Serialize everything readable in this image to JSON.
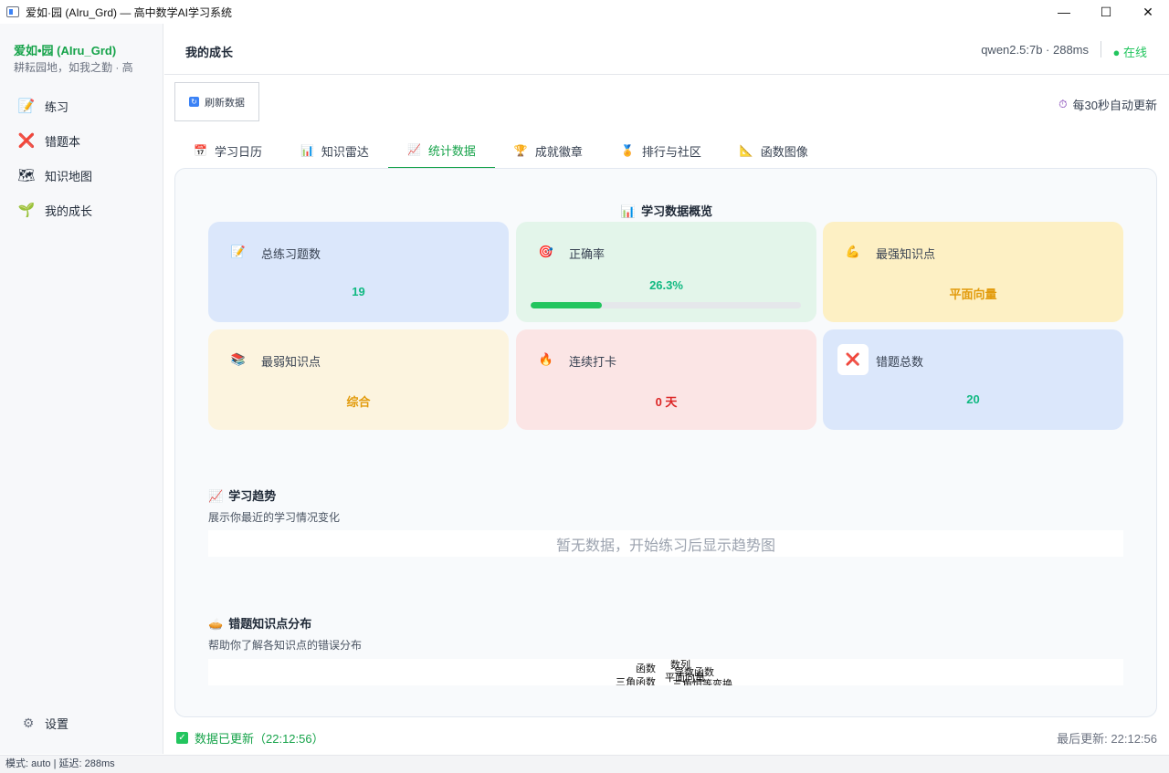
{
  "window": {
    "title": "爱如·园 (AIru_Grd) — 高中数学AI学习系统",
    "minimize_glyph": "—",
    "maximize_glyph": "☐",
    "close_glyph": "✕"
  },
  "sidebar": {
    "brand": "爱如•园 (AIru_Grd)",
    "slogan": "耕耘园地，如我之勤 · 高",
    "items": [
      {
        "label": "练习",
        "icon": "pencil-paper-icon",
        "glyph": "📝"
      },
      {
        "label": "错题本",
        "icon": "red-cross-icon",
        "glyph": "❌"
      },
      {
        "label": "知识地图",
        "icon": "world-map-icon",
        "glyph": "🗺"
      },
      {
        "label": "我的成长",
        "icon": "seedling-icon",
        "glyph": "🌱"
      }
    ],
    "settings": {
      "label": "设置",
      "icon": "gear-icon",
      "glyph": "⚙"
    }
  },
  "header": {
    "page_title": "我的成长",
    "model_info": "qwen2.5:7b · 288ms",
    "online_status": "● 在线"
  },
  "toolbar": {
    "refresh_label": "刷新数据",
    "auto_update": "每30秒自动更新"
  },
  "tabs": [
    {
      "label": "学习日历",
      "icon": "calendar-icon",
      "glyph": "📅"
    },
    {
      "label": "知识雷达",
      "icon": "bar-chart-icon",
      "glyph": "📊"
    },
    {
      "label": "统计数据",
      "icon": "trend-chart-icon",
      "glyph": "📈",
      "active": true
    },
    {
      "label": "成就徽章",
      "icon": "trophy-icon",
      "glyph": "🏆"
    },
    {
      "label": "排行与社区",
      "icon": "medal-icon",
      "glyph": "🏅"
    },
    {
      "label": "函数图像",
      "icon": "triangle-ruler-icon",
      "glyph": "📐"
    }
  ],
  "overview": {
    "title": "学习数据概览",
    "icon": "bar-chart-icon",
    "cards": [
      {
        "label": "总练习题数",
        "value": "19",
        "icon": "pencil-paper-icon",
        "glyph": "📝",
        "bg": "#dbe7fb",
        "value_color": "#10b981"
      },
      {
        "label": "正确率",
        "value": "26.3%",
        "icon": "target-icon",
        "glyph": "🎯",
        "bg": "#e3f5ea",
        "value_color": "#10b981",
        "progress": 0.263
      },
      {
        "label": "最强知识点",
        "value": "平面向量",
        "icon": "flexed-arm-icon",
        "glyph": "💪",
        "bg": "#fdf0c4",
        "value_color": "#e29b0c"
      },
      {
        "label": "最弱知识点",
        "value": "综合",
        "icon": "books-icon",
        "glyph": "📚",
        "bg": "#fcf4df",
        "value_color": "#e29b0c"
      },
      {
        "label": "连续打卡",
        "value": "0 天",
        "icon": "fire-icon",
        "glyph": "🔥",
        "bg": "#fbe5e5",
        "value_color": "#dc2626"
      },
      {
        "label": "错题总数",
        "value": "20",
        "icon": "red-cross-icon",
        "glyph": "❌",
        "bg": "#dbe7fb",
        "value_color": "#10b981"
      }
    ]
  },
  "trend": {
    "title": "学习趋势",
    "icon": "trend-chart-icon",
    "desc": "展示你最近的学习情况变化",
    "empty": "暂无数据，开始练习后显示趋势图"
  },
  "distribution": {
    "title": "错题知识点分布",
    "icon": "pie-icon",
    "desc": "帮助你了解各知识点的错误分布",
    "labels": [
      "函数",
      "数列",
      "导数函数",
      "三角函数",
      "平面向量",
      "三角恒等变换"
    ]
  },
  "status": {
    "updated": "数据已更新（22:12:56）",
    "last_update": "最后更新: 22:12:56"
  },
  "bottom_bar": "模式: auto | 延迟: 288ms"
}
